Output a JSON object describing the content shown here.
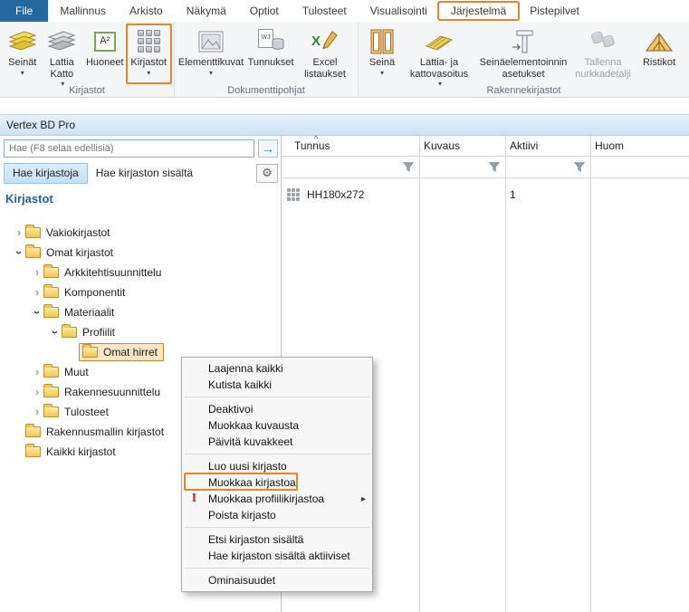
{
  "colors": {
    "accent_orange": "#E8822D",
    "file_tab_blue": "#2368A2",
    "heading_blue": "#1D5FA8",
    "selection_tan": "#F8E7C6",
    "ribbon_bg": "#F4F5F7",
    "panel_title_bg": "#D9E9F8"
  },
  "ribbon": {
    "tabs": [
      {
        "label": "File"
      },
      {
        "label": "Mallinnus"
      },
      {
        "label": "Arkisto"
      },
      {
        "label": "Näkymä"
      },
      {
        "label": "Optiot"
      },
      {
        "label": "Tulosteet"
      },
      {
        "label": "Visualisointi"
      },
      {
        "label": "Järjestelmä"
      },
      {
        "label": "Pistepilvet"
      }
    ],
    "groups": [
      {
        "label": "Kirjastot"
      },
      {
        "label": "Dokumenttipohjat"
      },
      {
        "label": "Rakennekirjastot"
      }
    ],
    "buttons": [
      {
        "label": "Seinät"
      },
      {
        "label": "Lattia Katto"
      },
      {
        "label": "Huoneet"
      },
      {
        "label": "Kirjastot"
      },
      {
        "label": "Elementtikuvat"
      },
      {
        "label": "Tunnukset"
      },
      {
        "label": "Excel listaukset"
      },
      {
        "label": "Seinä"
      },
      {
        "label": "Lattia- ja kattovasoitus"
      },
      {
        "label": "Seinäelementoinnin asetukset"
      },
      {
        "label": "Tallenna nurkkadetalji"
      },
      {
        "label": "Ristikot"
      }
    ]
  },
  "panel": {
    "title": "Vertex BD Pro",
    "search_placeholder": "Hae (F8 selaa edellisiä)",
    "tabs": [
      {
        "label": "Hae kirjastoja"
      },
      {
        "label": "Hae kirjaston sisältä"
      }
    ],
    "tree_heading": "Kirjastot",
    "tree": [
      {
        "label": "Vakiokirjastot"
      },
      {
        "label": "Omat kirjastot"
      },
      {
        "label": "Arkkitehtisuunnittelu"
      },
      {
        "label": "Komponentit"
      },
      {
        "label": "Materiaalit"
      },
      {
        "label": "Profiilit"
      },
      {
        "label": "Omat hirret"
      },
      {
        "label": "Muut"
      },
      {
        "label": "Rakennesuunnittelu"
      },
      {
        "label": "Tulosteet"
      },
      {
        "label": "Rakennusmallin kirjastot"
      },
      {
        "label": "Kaikki kirjastot"
      }
    ]
  },
  "context_menu": {
    "items": [
      {
        "label": "Laajenna kaikki"
      },
      {
        "label": "Kutista kaikki"
      },
      {
        "label": "Deaktivoi"
      },
      {
        "label": "Muokkaa kuvausta"
      },
      {
        "label": "Päivitä kuvakkeet"
      },
      {
        "label": "Luo uusi kirjasto"
      },
      {
        "label": "Muokkaa kirjastoa"
      },
      {
        "label": "Muokkaa profiilikirjastoa"
      },
      {
        "label": "Poista kirjasto"
      },
      {
        "label": "Etsi kirjaston sisältä"
      },
      {
        "label": "Hae kirjaston sisältä aktiiviset"
      },
      {
        "label": "Ominaisuudet"
      }
    ]
  },
  "table": {
    "columns": [
      {
        "label": "Tunnus"
      },
      {
        "label": "Kuvaus"
      },
      {
        "label": "Aktiivi"
      },
      {
        "label": "Huom"
      }
    ],
    "rows": [
      {
        "tunnus": "HH180x272",
        "kuvaus": "",
        "aktiivi": "1",
        "huom": ""
      }
    ]
  },
  "icons": {
    "dropdown_caret": "▾",
    "chevron": "›",
    "search_go": "→",
    "gear": "⚙",
    "sort_asc": "^",
    "submenu_arrow": "▸",
    "huoneet_glyph": "A²",
    "tunnukset_glyph": "WJ",
    "excel_glyph": "X",
    "profile_beam": "I"
  }
}
